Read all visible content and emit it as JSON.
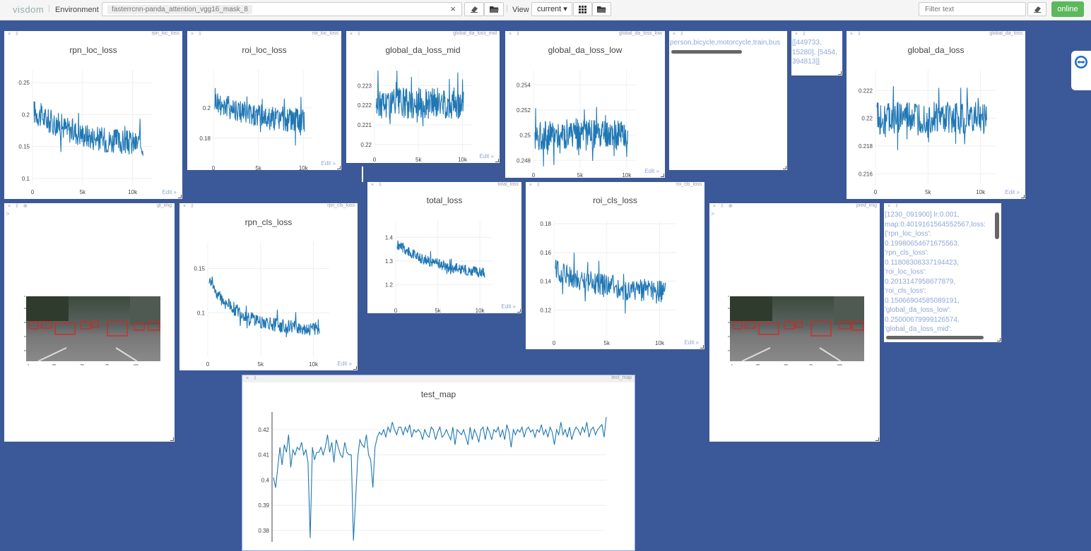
{
  "topbar": {
    "logo": "visdom",
    "divider": "|",
    "env_label": "Environment",
    "env_value": "fasterrcnn-panda_attention_vgg16_mask_8",
    "clear_icon": "×",
    "view_label": "View",
    "view_value": "current ▾",
    "filter_placeholder": "Filter text",
    "status": "online"
  },
  "side_icon": "teamviewer-icon",
  "panes": {
    "rpn_loc_loss": {
      "name": "rpn_loc_loss",
      "edit": "Edit »"
    },
    "roi_loc_loss": {
      "name": "roi_loc_loss",
      "edit": "Edit »"
    },
    "global_da_loss_mid": {
      "name": "global_da_loss_mid",
      "edit": "Edit »"
    },
    "global_da_loss_low": {
      "name": "global_da_loss_low",
      "edit": "Edit »"
    },
    "classes_text": {
      "text": "person,bicycle,motorcycle,train,bus"
    },
    "counts_text": {
      "text": "[[449733,\n15280], [5454,\n394813]]"
    },
    "global_da_loss": {
      "name": "global_da_loss",
      "edit": "Edit »"
    },
    "gt_img": {
      "name": "gt_img"
    },
    "rpn_cls_loss": {
      "name": "rpn_cls_loss",
      "edit": "Edit »"
    },
    "total_loss": {
      "name": "total_loss",
      "edit": "Edit »"
    },
    "roi_cls_loss": {
      "name": "roi_cls_loss",
      "edit": "Edit »"
    },
    "pred_img": {
      "name": "pred_img"
    },
    "log_text": {
      "text": "[1230_091900] lr:0.001,\nmap:0.4019161564552567,loss:\n{'rpn_loc_loss':\n0.19980654671675563,\n'rpn_cls_loss':\n0.11808308337194423,\n'roi_loc_loss':\n0.2013147958677879,\n'roi_cls_loss':\n0.15066904585089191,\n'global_da_loss_low':\n0.25000679999126574,\n'global_da_loss_mid':"
    },
    "test_map": {
      "name": "test_map"
    }
  },
  "chart_data": [
    {
      "id": "rpn_loc_loss",
      "type": "line",
      "title": "rpn_loc_loss",
      "x_ticks": [
        "0",
        "5k",
        "10k"
      ],
      "xlim": [
        0,
        12000
      ],
      "y_ticks": [
        0.1,
        0.15,
        0.2,
        0.25
      ],
      "ylim": [
        0.09,
        0.27
      ],
      "series": [
        {
          "values": [
            0.205,
            0.198,
            0.19,
            0.186,
            0.181,
            0.176,
            0.172,
            0.168,
            0.165,
            0.162,
            0.16,
            0.158,
            0.157,
            0.156,
            0.155,
            0.154
          ]
        }
      ],
      "noise": 0.02
    },
    {
      "id": "roi_loc_loss",
      "type": "line",
      "title": "roi_loc_loss",
      "x_ticks": [
        "0",
        "5k",
        "10k"
      ],
      "xlim": [
        0,
        11000
      ],
      "y_ticks": [
        0.18,
        0.2
      ],
      "ylim": [
        0.165,
        0.225
      ],
      "series": [
        {
          "values": [
            0.205,
            0.202,
            0.2,
            0.198,
            0.196,
            0.195,
            0.194,
            0.193,
            0.193,
            0.192,
            0.192,
            0.191
          ]
        }
      ],
      "noise": 0.008
    },
    {
      "id": "global_da_loss_mid",
      "type": "line",
      "title": "global_da_loss_mid",
      "x_ticks": [
        "0",
        "5k",
        "10k"
      ],
      "xlim": [
        0,
        11000
      ],
      "y_ticks": [
        0.22,
        0.221,
        0.222,
        0.223
      ],
      "ylim": [
        0.2196,
        0.2238
      ],
      "series": [
        {
          "values": [
            0.2221,
            0.2221,
            0.2221,
            0.2221,
            0.2221,
            0.2221,
            0.2221,
            0.2221
          ]
        }
      ],
      "noise": 0.0008
    },
    {
      "id": "global_da_loss_low",
      "type": "line",
      "title": "global_da_loss_low",
      "x_ticks": [
        "0",
        "5k",
        "10k"
      ],
      "xlim": [
        0,
        11000
      ],
      "y_ticks": [
        0.248,
        0.25,
        0.252,
        0.254
      ],
      "ylim": [
        0.2474,
        0.2552
      ],
      "series": [
        {
          "values": [
            0.25,
            0.25,
            0.25,
            0.25,
            0.25,
            0.25,
            0.25,
            0.25
          ]
        }
      ],
      "noise": 0.0012
    },
    {
      "id": "global_da_loss",
      "type": "line",
      "title": "global_da_loss",
      "x_ticks": [
        "0",
        "5k",
        "10k"
      ],
      "xlim": [
        0,
        11500
      ],
      "y_ticks": [
        0.216,
        0.218,
        0.22,
        0.222
      ],
      "ylim": [
        0.2152,
        0.2235
      ],
      "series": [
        {
          "values": [
            0.22,
            0.22,
            0.22,
            0.22,
            0.22,
            0.22,
            0.22,
            0.22
          ]
        }
      ],
      "noise": 0.0012
    },
    {
      "id": "rpn_cls_loss",
      "type": "line",
      "title": "rpn_cls_loss",
      "x_ticks": [
        "0",
        "5k",
        "10k"
      ],
      "xlim": [
        0,
        11500
      ],
      "y_ticks": [
        0.1,
        0.15
      ],
      "ylim": [
        0.05,
        0.18
      ],
      "series": [
        {
          "values": [
            0.14,
            0.12,
            0.11,
            0.102,
            0.096,
            0.092,
            0.089,
            0.087,
            0.085,
            0.084,
            0.083,
            0.082,
            0.081
          ]
        }
      ],
      "noise": 0.008
    },
    {
      "id": "total_loss",
      "type": "line",
      "title": "total_loss",
      "x_ticks": [
        "0",
        "5k",
        "10k"
      ],
      "xlim": [
        0,
        11500
      ],
      "y_ticks": [
        1.2,
        1.3,
        1.4
      ],
      "ylim": [
        1.12,
        1.47
      ],
      "series": [
        {
          "values": [
            1.37,
            1.35,
            1.33,
            1.31,
            1.3,
            1.29,
            1.28,
            1.27,
            1.265,
            1.26,
            1.255,
            1.25
          ]
        }
      ],
      "noise": 0.022
    },
    {
      "id": "roi_cls_loss",
      "type": "line",
      "title": "roi_cls_loss",
      "x_ticks": [
        "0",
        "5k",
        "10k"
      ],
      "xlim": [
        0,
        11500
      ],
      "y_ticks": [
        0.12,
        0.14,
        0.16,
        0.18
      ],
      "ylim": [
        0.102,
        0.182
      ],
      "series": [
        {
          "values": [
            0.148,
            0.145,
            0.142,
            0.14,
            0.138,
            0.137,
            0.136,
            0.135,
            0.134,
            0.134,
            0.133,
            0.133
          ]
        }
      ],
      "noise": 0.008
    },
    {
      "id": "test_map",
      "type": "line",
      "title": "test_map",
      "y_ticks": [
        0.38,
        0.39,
        0.4,
        0.41,
        0.42
      ],
      "ylim": [
        0.3755,
        0.427
      ],
      "series": [
        {
          "values": [
            0.401,
            0.397,
            0.405,
            0.413,
            0.406,
            0.414,
            0.411,
            0.418,
            0.405,
            0.412,
            0.41,
            0.413,
            0.412,
            0.415,
            0.41,
            0.412,
            0.407,
            0.377,
            0.413,
            0.408,
            0.411,
            0.411,
            0.413,
            0.41,
            0.413,
            0.418,
            0.411,
            0.415,
            0.407,
            0.416,
            0.413,
            0.41,
            0.409,
            0.415,
            0.411,
            0.41,
            0.41,
            0.376,
            0.392,
            0.409,
            0.416,
            0.414,
            0.413,
            0.418,
            0.41,
            0.408,
            0.397,
            0.413,
            0.417,
            0.419,
            0.418,
            0.42,
            0.417,
            0.421,
            0.419,
            0.423,
            0.42,
            0.418,
            0.421,
            0.421,
            0.418,
            0.421,
            0.419,
            0.422,
            0.417,
            0.42,
            0.419,
            0.42,
            0.419,
            0.416,
            0.42,
            0.418,
            0.417,
            0.421,
            0.42,
            0.416,
            0.419,
            0.421,
            0.417,
            0.418,
            0.42,
            0.418,
            0.416,
            0.421,
            0.414,
            0.42,
            0.419,
            0.418,
            0.42,
            0.417,
            0.414,
            0.421,
            0.416,
            0.42,
            0.418,
            0.415,
            0.42,
            0.421,
            0.416,
            0.421,
            0.419,
            0.416,
            0.42,
            0.419,
            0.421,
            0.417,
            0.42,
            0.416,
            0.422,
            0.419,
            0.413,
            0.42,
            0.418,
            0.42,
            0.419,
            0.421,
            0.417,
            0.42,
            0.421,
            0.419,
            0.42,
            0.417,
            0.42,
            0.419,
            0.422,
            0.418,
            0.42,
            0.417,
            0.421,
            0.419,
            0.414,
            0.42,
            0.418,
            0.423,
            0.418,
            0.42,
            0.417,
            0.421,
            0.416,
            0.419,
            0.421,
            0.42,
            0.418,
            0.421,
            0.419,
            0.423,
            0.417,
            0.42,
            0.421,
            0.418,
            0.42,
            0.421,
            0.422,
            0.417,
            0.425
          ]
        }
      ]
    }
  ]
}
